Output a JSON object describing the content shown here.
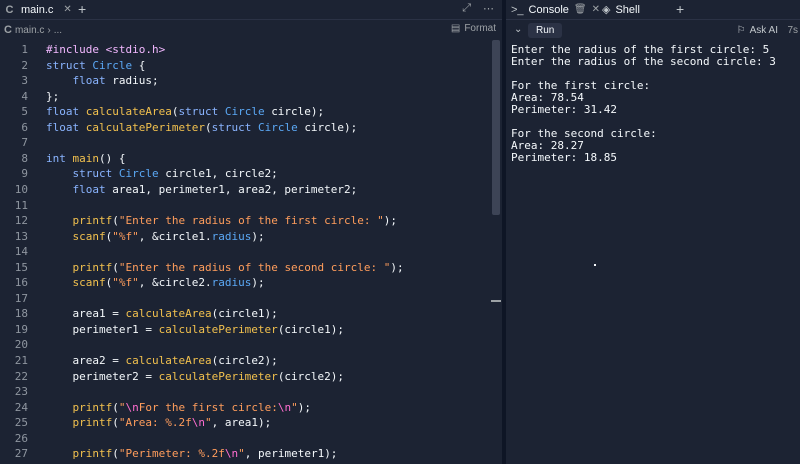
{
  "editor": {
    "tab_label": "main.c",
    "breadcrumb_file": "main.c",
    "breadcrumb_more": "...",
    "format_label": "Format",
    "lines": [
      [
        [
          "pre",
          "#include <stdio.h>"
        ]
      ],
      [
        [
          "kw",
          "struct "
        ],
        [
          "type",
          "Circle"
        ],
        [
          "plain",
          " {"
        ]
      ],
      [
        [
          "plain",
          "    "
        ],
        [
          "kw",
          "float "
        ],
        [
          "plain",
          "radius;"
        ]
      ],
      [
        [
          "plain",
          "};"
        ]
      ],
      [
        [
          "kw",
          "float "
        ],
        [
          "fn",
          "calculateArea"
        ],
        [
          "plain",
          "("
        ],
        [
          "kw",
          "struct "
        ],
        [
          "type",
          "Circle "
        ],
        [
          "plain",
          "circle);"
        ]
      ],
      [
        [
          "kw",
          "float "
        ],
        [
          "fn",
          "calculatePerimeter"
        ],
        [
          "plain",
          "("
        ],
        [
          "kw",
          "struct "
        ],
        [
          "type",
          "Circle "
        ],
        [
          "plain",
          "circle);"
        ]
      ],
      [
        [
          "plain",
          ""
        ]
      ],
      [
        [
          "kw",
          "int "
        ],
        [
          "fn",
          "main"
        ],
        [
          "plain",
          "() {"
        ]
      ],
      [
        [
          "plain",
          "    "
        ],
        [
          "kw",
          "struct "
        ],
        [
          "type",
          "Circle "
        ],
        [
          "plain",
          "circle1, circle2;"
        ]
      ],
      [
        [
          "plain",
          "    "
        ],
        [
          "kw",
          "float "
        ],
        [
          "plain",
          "area1, perimeter1, area2, perimeter2;"
        ]
      ],
      [
        [
          "plain",
          ""
        ]
      ],
      [
        [
          "plain",
          "    "
        ],
        [
          "fn",
          "printf"
        ],
        [
          "plain",
          "("
        ],
        [
          "str",
          "\"Enter the radius of the first circle: \""
        ],
        [
          "plain",
          ");"
        ]
      ],
      [
        [
          "plain",
          "    "
        ],
        [
          "fn",
          "scanf"
        ],
        [
          "plain",
          "("
        ],
        [
          "str",
          "\"%f\""
        ],
        [
          "plain",
          ", &circle1."
        ],
        [
          "type",
          "radius"
        ],
        [
          "plain",
          ");"
        ]
      ],
      [
        [
          "plain",
          ""
        ]
      ],
      [
        [
          "plain",
          "    "
        ],
        [
          "fn",
          "printf"
        ],
        [
          "plain",
          "("
        ],
        [
          "str",
          "\"Enter the radius of the second circle: \""
        ],
        [
          "plain",
          ");"
        ]
      ],
      [
        [
          "plain",
          "    "
        ],
        [
          "fn",
          "scanf"
        ],
        [
          "plain",
          "("
        ],
        [
          "str",
          "\"%f\""
        ],
        [
          "plain",
          ", &circle2."
        ],
        [
          "type",
          "radius"
        ],
        [
          "plain",
          ");"
        ]
      ],
      [
        [
          "plain",
          ""
        ]
      ],
      [
        [
          "plain",
          "    area1 = "
        ],
        [
          "fn",
          "calculateArea"
        ],
        [
          "plain",
          "(circle1);"
        ]
      ],
      [
        [
          "plain",
          "    perimeter1 = "
        ],
        [
          "fn",
          "calculatePerimeter"
        ],
        [
          "plain",
          "(circle1);"
        ]
      ],
      [
        [
          "plain",
          ""
        ]
      ],
      [
        [
          "plain",
          "    area2 = "
        ],
        [
          "fn",
          "calculateArea"
        ],
        [
          "plain",
          "(circle2);"
        ]
      ],
      [
        [
          "plain",
          "    perimeter2 = "
        ],
        [
          "fn",
          "calculatePerimeter"
        ],
        [
          "plain",
          "(circle2);"
        ]
      ],
      [
        [
          "plain",
          ""
        ]
      ],
      [
        [
          "plain",
          "    "
        ],
        [
          "fn",
          "printf"
        ],
        [
          "plain",
          "("
        ],
        [
          "str",
          "\""
        ],
        [
          "esc",
          "\\n"
        ],
        [
          "str",
          "For the first circle:"
        ],
        [
          "esc",
          "\\n"
        ],
        [
          "str",
          "\""
        ],
        [
          "plain",
          ");"
        ]
      ],
      [
        [
          "plain",
          "    "
        ],
        [
          "fn",
          "printf"
        ],
        [
          "plain",
          "("
        ],
        [
          "str",
          "\"Area: %.2f"
        ],
        [
          "esc",
          "\\n"
        ],
        [
          "str",
          "\""
        ],
        [
          "plain",
          ", area1);"
        ]
      ],
      [
        [
          "plain",
          ""
        ]
      ],
      [
        [
          "plain",
          "    "
        ],
        [
          "fn",
          "printf"
        ],
        [
          "plain",
          "("
        ],
        [
          "str",
          "\"Perimeter: %.2f"
        ],
        [
          "esc",
          "\\n"
        ],
        [
          "str",
          "\""
        ],
        [
          "plain",
          ", perimeter1);"
        ]
      ]
    ]
  },
  "console": {
    "tab_console": "Console",
    "tab_shell": "Shell",
    "run_label": "Run",
    "ask_ai_label": "Ask AI",
    "time_label": "7s",
    "output": "Enter the radius of the first circle: 5\nEnter the radius of the second circle: 3\n\nFor the first circle:\nArea: 78.54\nPerimeter: 31.42\n\nFor the second circle:\nArea: 28.27\nPerimeter: 18.85"
  },
  "icons": [
    "c-file-icon",
    "close-icon",
    "plus-icon",
    "expand-icon",
    "more-icon",
    "chevron-right-icon",
    "format-icon",
    "terminal-icon",
    "trash-icon",
    "shell-icon",
    "chevron-down-icon",
    "ask-ai-icon"
  ]
}
